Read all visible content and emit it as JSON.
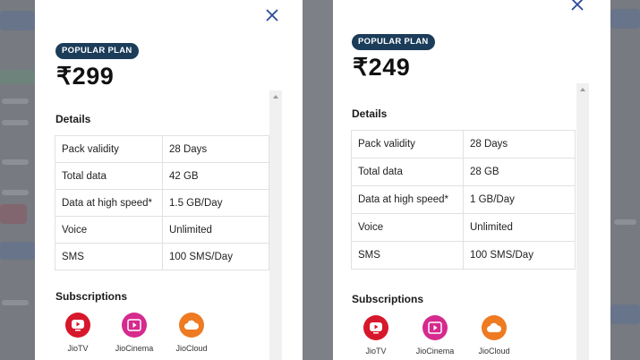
{
  "plans": [
    {
      "badge": "POPULAR PLAN",
      "price": "₹299",
      "details_title": "Details",
      "rows": [
        {
          "label": "Pack validity",
          "value": "28 Days"
        },
        {
          "label": "Total data",
          "value": "42 GB"
        },
        {
          "label": "Data at high speed*",
          "value": "1.5 GB/Day"
        },
        {
          "label": "Voice",
          "value": "Unlimited"
        },
        {
          "label": "SMS",
          "value": "100 SMS/Day"
        }
      ],
      "subscriptions_title": "Subscriptions",
      "subscriptions": [
        {
          "name": "JioTV",
          "icon": "jiotv-icon",
          "color": "#d7172b"
        },
        {
          "name": "JioCinema",
          "icon": "jiocinema-icon",
          "color": "#d52a8e"
        },
        {
          "name": "JioCloud",
          "icon": "jiocloud-icon",
          "color": "#ee7a22"
        }
      ]
    },
    {
      "badge": "POPULAR PLAN",
      "price": "₹249",
      "details_title": "Details",
      "rows": [
        {
          "label": "Pack validity",
          "value": "28 Days"
        },
        {
          "label": "Total data",
          "value": "28 GB"
        },
        {
          "label": "Data at high speed*",
          "value": "1 GB/Day"
        },
        {
          "label": "Voice",
          "value": "Unlimited"
        },
        {
          "label": "SMS",
          "value": "100 SMS/Day"
        }
      ],
      "subscriptions_title": "Subscriptions",
      "subscriptions": [
        {
          "name": "JioTV",
          "icon": "jiotv-icon",
          "color": "#d7172b"
        },
        {
          "name": "JioCinema",
          "icon": "jiocinema-icon",
          "color": "#d52a8e"
        },
        {
          "name": "JioCloud",
          "icon": "jiocloud-icon",
          "color": "#ee7a22"
        }
      ]
    }
  ],
  "colors": {
    "badge": "#1c3d5a",
    "close": "#2b4a9b",
    "overlay": "#777a80"
  }
}
